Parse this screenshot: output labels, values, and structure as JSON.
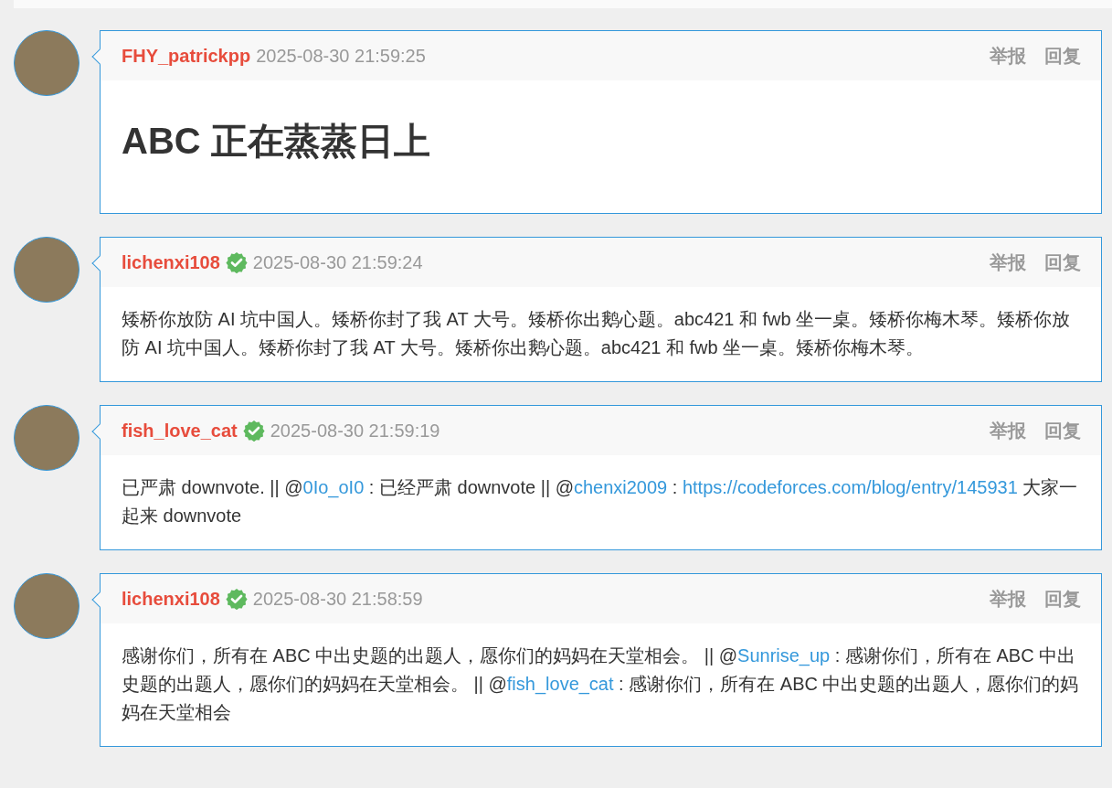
{
  "comments": [
    {
      "user": "FHY_patrickpp",
      "verified": false,
      "time": "2025-08-30 21:59:25",
      "actions": [
        "举报",
        "回复"
      ],
      "body": {
        "kind": "heading",
        "segments": [
          {
            "kind": "text",
            "text": "ABC 正在蒸蒸日上"
          }
        ]
      }
    },
    {
      "user": "lichenxi108",
      "verified": true,
      "time": "2025-08-30 21:59:24",
      "actions": [
        "举报",
        "回复"
      ],
      "body": {
        "kind": "paragraph",
        "segments": [
          {
            "kind": "text",
            "text": "矮桥你放防 AI 坑中国人。矮桥你封了我 AT 大号。矮桥你出鹅心题。abc421 和 fwb 坐一桌。矮桥你梅木琴。矮桥你放防 AI 坑中国人。矮桥你封了我 AT 大号。矮桥你出鹅心题。abc421 和 fwb 坐一桌。矮桥你梅木琴。"
          }
        ]
      }
    },
    {
      "user": "fish_love_cat",
      "verified": true,
      "time": "2025-08-30 21:59:19",
      "actions": [
        "举报",
        "回复"
      ],
      "body": {
        "kind": "paragraph",
        "segments": [
          {
            "kind": "text",
            "text": "已严肃 downvote. || @"
          },
          {
            "kind": "link",
            "text": "0Io_oI0"
          },
          {
            "kind": "text",
            "text": " : 已经严肃 downvote || @"
          },
          {
            "kind": "link",
            "text": "chenxi2009"
          },
          {
            "kind": "text",
            "text": " : "
          },
          {
            "kind": "link",
            "text": "https://codeforces.com/blog/entry/145931"
          },
          {
            "kind": "text",
            "text": " 大家一起来 downvote"
          }
        ]
      }
    },
    {
      "user": "lichenxi108",
      "verified": true,
      "time": "2025-08-30 21:58:59",
      "actions": [
        "举报",
        "回复"
      ],
      "body": {
        "kind": "paragraph",
        "segments": [
          {
            "kind": "text",
            "text": "感谢你们，所有在 ABC 中出史题的出题人，愿你们的妈妈在天堂相会。 || @"
          },
          {
            "kind": "link",
            "text": "Sunrise_up"
          },
          {
            "kind": "text",
            "text": " : 感谢你们，所有在 ABC 中出史题的出题人，愿你们的妈妈在天堂相会。 || @"
          },
          {
            "kind": "link",
            "text": "fish_love_cat"
          },
          {
            "kind": "text",
            "text": " : 感谢你们，所有在 ABC 中出史题的出题人，愿你们的妈妈在天堂相会"
          }
        ]
      }
    }
  ]
}
